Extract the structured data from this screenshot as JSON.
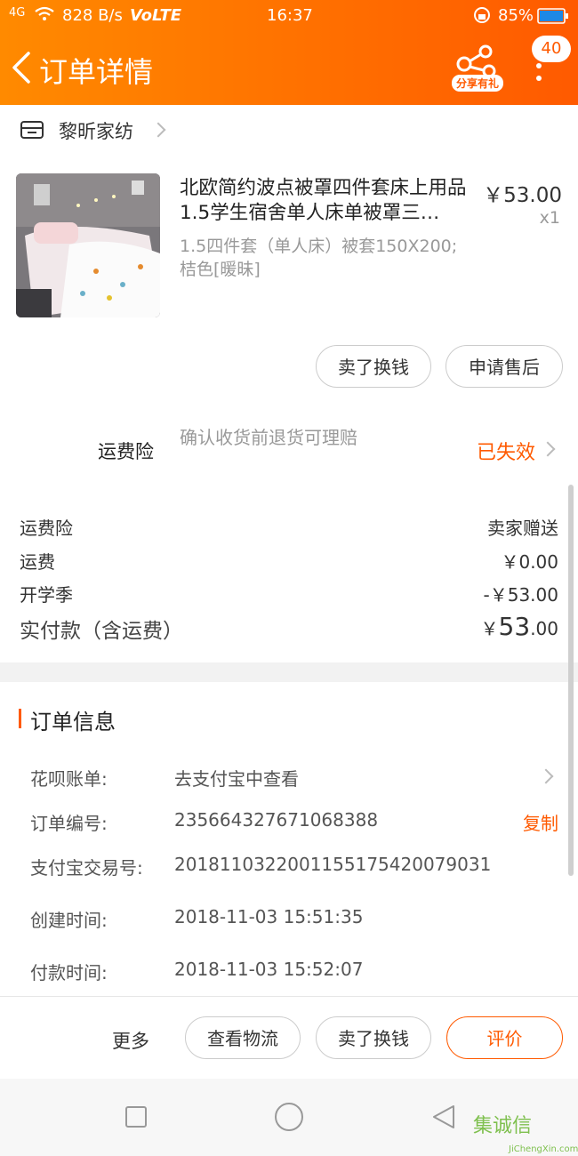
{
  "status": {
    "signal": "4G",
    "speed": "828 B/s",
    "volte": "VoLTE",
    "time": "16:37",
    "battery": "85%"
  },
  "header": {
    "title": "订单详情",
    "share_label": "分享有礼",
    "badge": "40",
    "colors": {
      "accent": "#ff5a00",
      "gradient_start": "#ff8a00"
    }
  },
  "shop": {
    "name": "黎昕家纺"
  },
  "product": {
    "title": "北欧简约波点被罩四件套床上用品1.5学生宿舍单人床单被罩三…",
    "sku": "1.5四件套（单人床）被套150X200;桔色[暖昧]",
    "price": "￥53.00",
    "qty": "x1",
    "actions": [
      "卖了换钱",
      "申请售后"
    ]
  },
  "insurance": {
    "label": "运费险",
    "desc": "确认收货前退货可理赔",
    "status": "已失效"
  },
  "costs": {
    "rows": [
      {
        "label": "运费险",
        "value": "卖家赠送"
      },
      {
        "label": "运费",
        "value": "￥0.00"
      },
      {
        "label": "开学季",
        "value": "-￥53.00"
      }
    ],
    "total_label": "实付款（含运费）",
    "total_symbol": "￥",
    "total_int": "53",
    "total_dec": ".00"
  },
  "order_info": {
    "title": "订单信息",
    "rows": [
      {
        "label": "花呗账单:",
        "value": "去支付宝中查看",
        "action": ""
      },
      {
        "label": "订单编号:",
        "value": "235664327671068388",
        "action": "复制"
      },
      {
        "label": "支付宝交易号:",
        "value": "2018110322001155175420079031",
        "action": ""
      },
      {
        "label": "创建时间:",
        "value": "2018-11-03 15:51:35",
        "action": ""
      },
      {
        "label": "付款时间:",
        "value": "2018-11-03 15:52:07",
        "action": ""
      }
    ]
  },
  "bottom": {
    "more": "更多",
    "buttons": [
      "查看物流",
      "卖了换钱",
      "评价"
    ]
  },
  "watermark": {
    "text": "集诚信",
    "sub": "JiChengXin.com"
  }
}
